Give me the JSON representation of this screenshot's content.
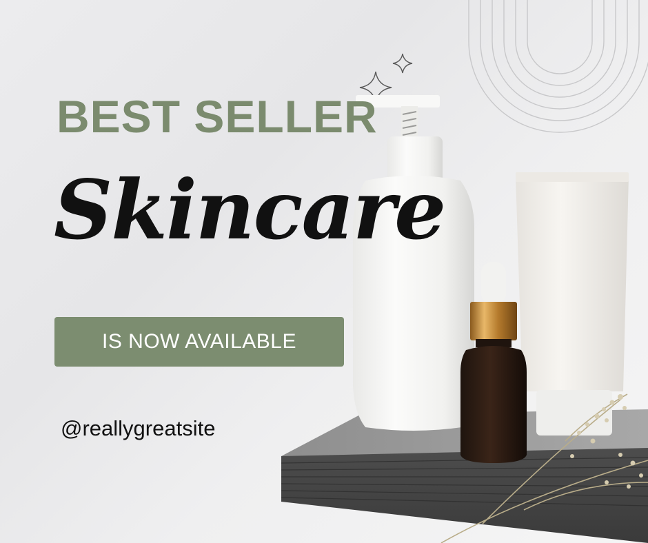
{
  "promo": {
    "headline": "BEST SELLER",
    "script_title": "Skincare",
    "cta_label": "IS NOW AVAILABLE",
    "handle": "@reallygreatsite"
  },
  "colors": {
    "accent_green": "#7c8d70",
    "headline_green": "#7b8b6e",
    "text_dark": "#111111",
    "background": "#ececee"
  },
  "icons": [
    "sparkle-icon",
    "arch-lines-icon",
    "dried-flower-icon"
  ]
}
